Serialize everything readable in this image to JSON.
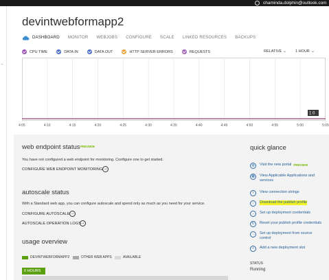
{
  "topbar": {
    "account": "chaminda.dolphin@outlook.com",
    "icon": "globe-icon"
  },
  "header": {
    "title": "devintwebformapp2",
    "tabs": [
      {
        "label": "DASHBOARD",
        "active": true
      },
      {
        "label": "MONITOR",
        "active": false
      },
      {
        "label": "WEBJOBS",
        "active": false
      },
      {
        "label": "CONFIGURE",
        "active": false
      },
      {
        "label": "SCALE",
        "active": false
      },
      {
        "label": "LINKED RESOURCES",
        "active": false
      },
      {
        "label": "BACKUPS",
        "active": false
      }
    ]
  },
  "legend": {
    "items": [
      {
        "label": "CPU TIME",
        "color": "#9b4fb5"
      },
      {
        "label": "DATA IN",
        "color": "#4b6fc4"
      },
      {
        "label": "DATA OUT",
        "color": "#4b6fc4"
      },
      {
        "label": "HTTP SERVER ERRORS",
        "color": "#e8a33c"
      },
      {
        "label": "REQUESTS",
        "color": "#a064b8"
      }
    ],
    "relative_label": "RELATIVE",
    "range_label": "1 HOUR"
  },
  "chart_data": {
    "type": "line",
    "x": [
      "4:05",
      "4:10",
      "4:15",
      "4:20",
      "4:25",
      "4:30",
      "4:35",
      "4:40",
      "4:45",
      "4:50",
      "4:55",
      "5:00",
      "5:05"
    ],
    "series": [
      {
        "name": "",
        "values": [
          0,
          0,
          0,
          0,
          0,
          0,
          0,
          0,
          0,
          0,
          0,
          0,
          0
        ],
        "color": "#a8628c"
      }
    ],
    "end_badge": "1 0",
    "grid": true
  },
  "web_endpoint": {
    "title": "web endpoint status",
    "preview": "PREVIEW",
    "text": "You have not configured a web endpoint for monitoring. Configure one to get started.",
    "link": "CONFIGURE WEB ENDPOINT MONITORING"
  },
  "autoscale": {
    "title": "autoscale status",
    "text": "With a Standard web app, you can configure autoscale and spend only as much as you need for your service.",
    "link1": "CONFIGURE AUTOSCALE",
    "link2": "AUTOSCALE OPERATION LOGS"
  },
  "usage": {
    "title": "usage overview",
    "legend": [
      {
        "label": "DEVINTWEBFORMAPP2",
        "color": "#5ca012"
      },
      {
        "label": "OTHER WEB APPS",
        "color": "#a9a9a9"
      },
      {
        "label": "AVAILABLE",
        "color": "#d9d9d9"
      }
    ],
    "hours": "0 HOURS"
  },
  "quick_glance": {
    "title": "quick glance",
    "items": [
      {
        "label": "Visit the new portal",
        "preview": "PREVIEW",
        "highlight": false
      },
      {
        "label": "View Applicable Applications and services",
        "preview": "",
        "highlight": false
      },
      {
        "label": "View connection strings",
        "preview": "",
        "highlight": false
      },
      {
        "label": "Download the publish profile",
        "preview": "",
        "highlight": true
      },
      {
        "label": "Set up deployment credentials",
        "preview": "",
        "highlight": false
      },
      {
        "label": "Reset your publish profile credentials",
        "preview": "",
        "highlight": false
      },
      {
        "label": "Set up deployment from source control",
        "preview": "",
        "highlight": false
      },
      {
        "label": "Add a new deployment slot",
        "preview": "",
        "highlight": false
      }
    ],
    "status_label": "STATUS",
    "status_value": "Running"
  }
}
